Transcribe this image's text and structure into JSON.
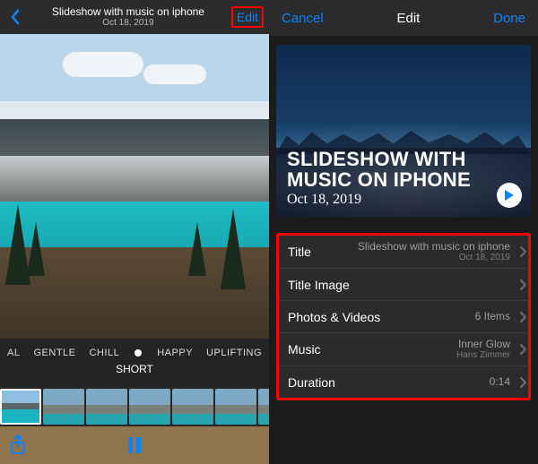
{
  "left": {
    "header": {
      "title": "Slideshow with music on iphone",
      "date": "Oct 18, 2019",
      "edit": "Edit"
    },
    "moods": [
      "AL",
      "GENTLE",
      "CHILL",
      "HAPPY",
      "UPLIFTING"
    ],
    "short_label": "SHORT"
  },
  "right": {
    "header": {
      "cancel": "Cancel",
      "title": "Edit",
      "done": "Done"
    },
    "preview": {
      "title": "SLIDESHOW WITH MUSIC ON IPHONE",
      "subtitle": "Oct 18, 2019"
    },
    "rows": {
      "title": {
        "label": "Title",
        "value": "Slideshow with music on iphone",
        "sub": "Oct 18, 2019"
      },
      "title_image": {
        "label": "Title Image",
        "value": ""
      },
      "photos": {
        "label": "Photos & Videos",
        "value": "6 Items"
      },
      "music": {
        "label": "Music",
        "value": "Inner Glow",
        "sub": "Hans Zimmer"
      },
      "duration": {
        "label": "Duration",
        "value": "0:14"
      }
    }
  }
}
